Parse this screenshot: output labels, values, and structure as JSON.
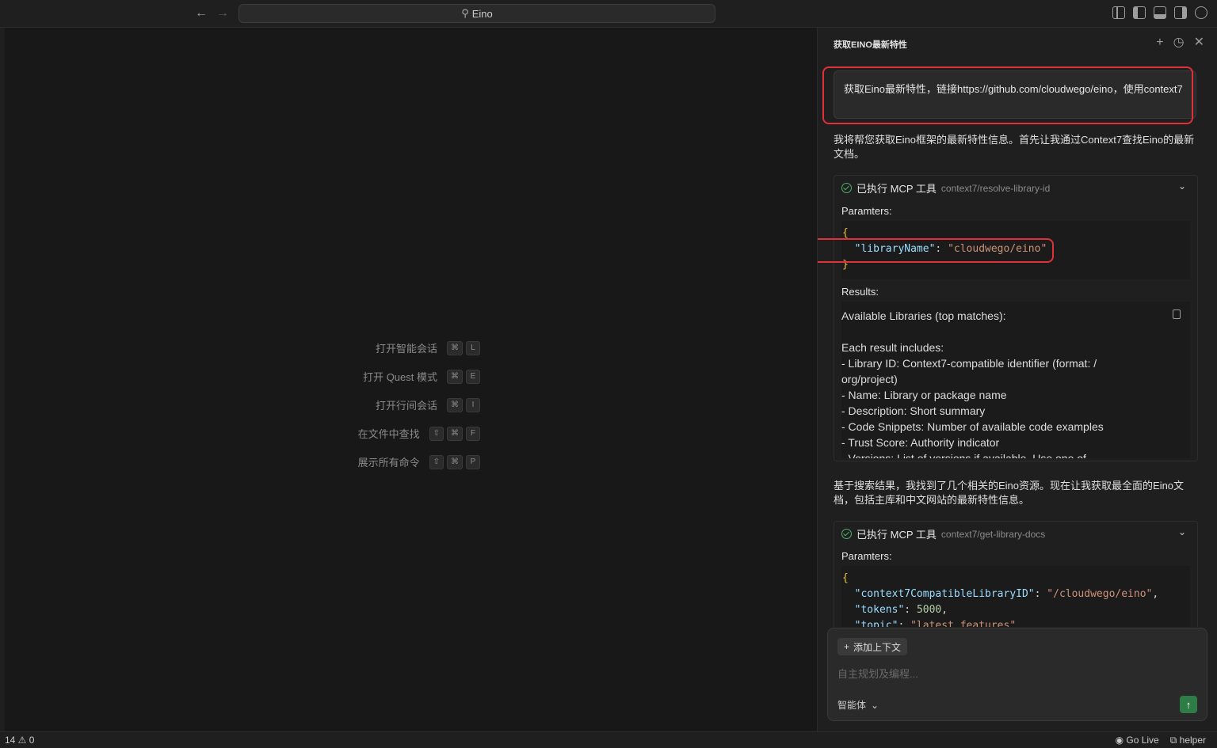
{
  "titlebar": {
    "back_icon": "arrow-left-icon",
    "forward_icon": "arrow-right-icon",
    "search_text": "Eino"
  },
  "editor": {
    "shortcuts": [
      {
        "label": "打开智能会话",
        "keys": [
          "⌘",
          "L"
        ]
      },
      {
        "label": "打开 Quest 模式",
        "keys": [
          "⌘",
          "E"
        ]
      },
      {
        "label": "打开行间会话",
        "keys": [
          "⌘",
          "I"
        ]
      },
      {
        "label": "在文件中查找",
        "keys": [
          "⇧",
          "⌘",
          "F"
        ]
      },
      {
        "label": "展示所有命令",
        "keys": [
          "⇧",
          "⌘",
          "P"
        ]
      }
    ]
  },
  "panel": {
    "title": "获取EINO最新特性",
    "user_message": "获取Eino最新特性，链接https://github.com/cloudwego/eino，使用context7",
    "assistant_msg_1": "我将帮您获取Eino框架的最新特性信息。首先让我通过Context7查找Eino的最新文档。",
    "tool1": {
      "status": "已执行 MCP 工具",
      "tool_id": "context7/resolve-library-id",
      "params_label": "Paramters:",
      "param_key": "\"libraryName\"",
      "param_value": "\"cloudwego/eino\"",
      "results_label": "Results:",
      "results_lines": [
        "Available Libraries (top matches):",
        "",
        "Each result includes:",
        "- Library ID: Context7-compatible identifier (format: /",
        "org/project)",
        "- Name: Library or package name",
        "- Description: Short summary",
        "- Code Snippets: Number of available code examples",
        "- Trust Score: Authority indicator",
        "- Versions: List of versions if available. Use one of"
      ]
    },
    "assistant_msg_2": "基于搜索结果，我找到了几个相关的Eino资源。现在让我获取最全面的Eino文档，包括主库和中文网站的最新特性信息。",
    "tool2": {
      "status": "已执行 MCP 工具",
      "tool_id": "context7/get-library-docs",
      "params_label": "Paramters:",
      "k1": "\"context7CompatibleLibraryID\"",
      "v1": "\"/cloudwego/eino\"",
      "k2": "\"tokens\"",
      "v2": "5000",
      "k3": "\"topic\"",
      "v3": "\"latest features\""
    },
    "composer": {
      "add_context": "添加上下文",
      "placeholder": "自主规划及编程...",
      "agent_label": "智能体"
    }
  },
  "statusbar": {
    "problems": "14 ⚠ 0",
    "go_live": "Go Live",
    "helper": "helper"
  }
}
